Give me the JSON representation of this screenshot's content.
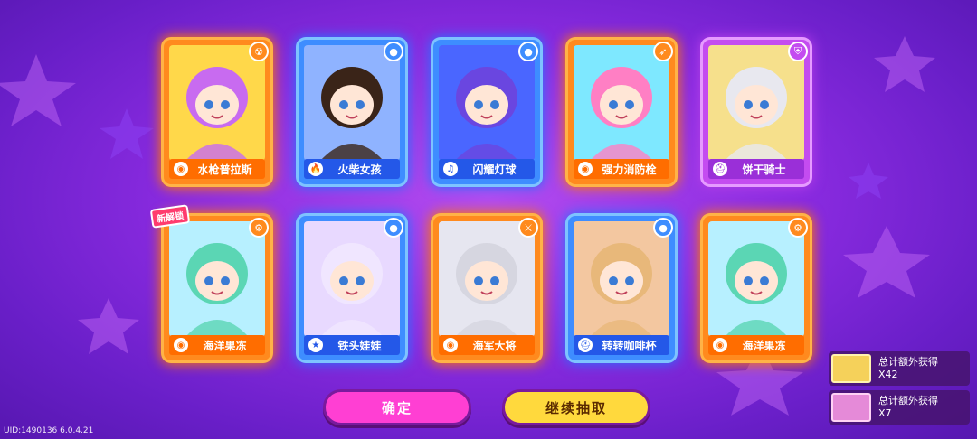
{
  "cards": [
    {
      "name": "水枪普拉斯",
      "frame": "orange",
      "icon": "ring-icon",
      "icon_glyph": "◉",
      "badge": "radiation-badge",
      "badge_glyph": "☢",
      "hair": "#c86bf0",
      "bg": "#ffd84a",
      "new": false
    },
    {
      "name": "火柴女孩",
      "frame": "blue",
      "icon": "flame-icon",
      "icon_glyph": "🔥",
      "badge": "bomb-badge",
      "badge_glyph": "●",
      "hair": "#3a2418",
      "bg": "#8fb3ff",
      "new": false
    },
    {
      "name": "闪耀灯球",
      "frame": "blue",
      "icon": "music-note-icon",
      "icon_glyph": "♫",
      "badge": "bomb-badge",
      "badge_glyph": "●",
      "hair": "#6a46e0",
      "bg": "#4a66ff",
      "new": false
    },
    {
      "name": "强力消防栓",
      "frame": "orange",
      "icon": "ring-icon",
      "icon_glyph": "◉",
      "badge": "bow-badge",
      "badge_glyph": "➶",
      "hair": "#ff7fc4",
      "bg": "#7ee8ff",
      "new": false
    },
    {
      "name": "饼干骑士",
      "frame": "purple",
      "icon": "helmet-icon",
      "icon_glyph": "⛑",
      "badge": "shield-badge",
      "badge_glyph": "⛨",
      "hair": "#e8e8ef",
      "bg": "#f6e08c",
      "new": false
    },
    {
      "name": "海洋果冻",
      "frame": "orange",
      "icon": "ring-icon",
      "icon_glyph": "◉",
      "badge": "gear-badge",
      "badge_glyph": "⚙",
      "hair": "#5bd6b4",
      "bg": "#b7f0ff",
      "new": true
    },
    {
      "name": "铁头娃娃",
      "frame": "blue",
      "icon": "star-icon",
      "icon_glyph": "★",
      "badge": "bomb-badge",
      "badge_glyph": "●",
      "hair": "#f0e6ff",
      "bg": "#e8d9ff",
      "new": false
    },
    {
      "name": "海军大将",
      "frame": "orange",
      "icon": "ring-icon",
      "icon_glyph": "◉",
      "badge": "sword-badge",
      "badge_glyph": "⚔",
      "hair": "#d6d6e0",
      "bg": "#e6e6f0",
      "new": false
    },
    {
      "name": "转转咖啡杯",
      "frame": "blue",
      "icon": "helmet-icon",
      "icon_glyph": "⛑",
      "badge": "bomb-badge",
      "badge_glyph": "●",
      "hair": "#e8b87a",
      "bg": "#f3c7a0",
      "new": false
    },
    {
      "name": "海洋果冻",
      "frame": "orange",
      "icon": "ring-icon",
      "icon_glyph": "◉",
      "badge": "gear-badge",
      "badge_glyph": "⚙",
      "hair": "#5bd6b4",
      "bg": "#b7f0ff",
      "new": false
    }
  ],
  "new_tag_label": "新解锁",
  "buttons": {
    "confirm": "确定",
    "continue": "继续抽取"
  },
  "rewards": [
    {
      "label": "总计额外获得",
      "count": "X42",
      "ticket": "gold"
    },
    {
      "label": "总计额外获得",
      "count": "X7",
      "ticket": "pink"
    }
  ],
  "uid": "UID:1490136 6.0.4.21",
  "colors": {
    "bg": "#8a2be0",
    "orange_frame": "#ff8a1e",
    "blue_frame": "#3e8dff",
    "purple_frame": "#c44cf0",
    "confirm": "#ff3fd3",
    "continue": "#ffd93d"
  }
}
